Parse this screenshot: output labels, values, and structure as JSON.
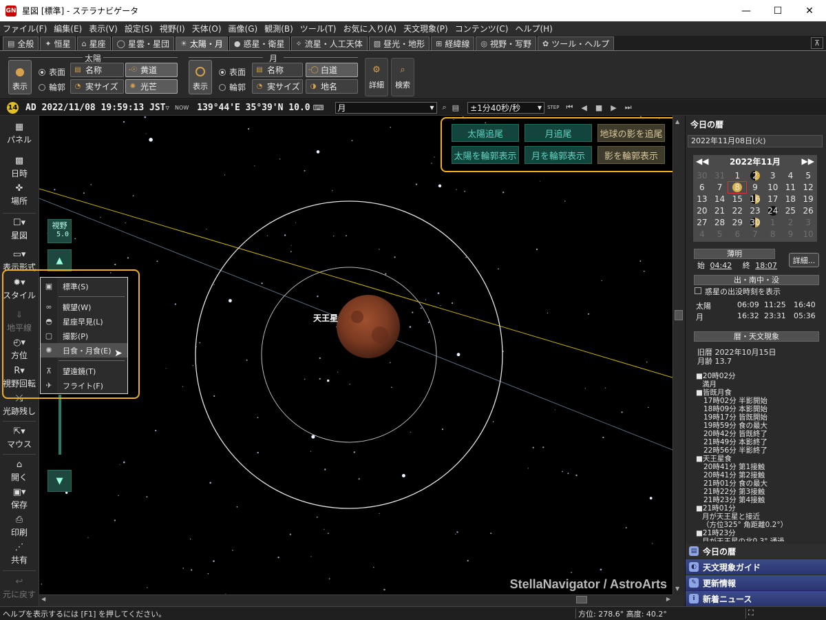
{
  "window": {
    "app_icon_text": "GN",
    "title": "星図 [標準] - ステラナビゲータ",
    "minimize": "—",
    "maximize": "☐",
    "close": "✕"
  },
  "menu": [
    "ファイル(F)",
    "編集(E)",
    "表示(V)",
    "設定(S)",
    "視野(I)",
    "天体(O)",
    "画像(G)",
    "観測(B)",
    "ツール(T)",
    "お気に入り(A)",
    "天文現象(P)",
    "コンテンツ(C)",
    "ヘルプ(H)"
  ],
  "tabs": [
    {
      "icon": "▤",
      "label": "全般"
    },
    {
      "icon": "✦",
      "label": "恒星"
    },
    {
      "icon": "⌂",
      "label": "星座"
    },
    {
      "icon": "◯",
      "label": "星雲・星団"
    },
    {
      "icon": "☀",
      "label": "太陽・月"
    },
    {
      "icon": "●",
      "label": "惑星・衛星"
    },
    {
      "icon": "✧",
      "label": "流星・人工天体"
    },
    {
      "icon": "▧",
      "label": "昼光・地形"
    },
    {
      "icon": "⊞",
      "label": "経緯線"
    },
    {
      "icon": "◎",
      "label": "視野・写野"
    },
    {
      "icon": "✿",
      "label": "ツール・ヘルプ"
    }
  ],
  "active_tab_index": 4,
  "pin_icon": "⊼",
  "ribbon": {
    "sun": {
      "group": "太陽",
      "show": "表示",
      "radio_surface": "表面",
      "radio_outline": "輪郭",
      "name": "名称",
      "real_size": "実サイズ",
      "ecliptic": "黄道",
      "corona": "光芒"
    },
    "moon": {
      "group": "月",
      "show": "表示",
      "radio_surface": "表面",
      "radio_outline": "輪郭",
      "name": "名称",
      "real_size": "実サイズ",
      "white_path": "白道",
      "place_name": "地名"
    },
    "detail": "詳細",
    "search": "検索"
  },
  "timebar": {
    "moon_age": "14",
    "datetime": "AD 2022/11/08 19:59:13 JST",
    "tz_mark": "▿",
    "now_label": "NOW",
    "location": "139°44'E 35°39'N 10.0",
    "target": "月",
    "step": "±1分40秒/秒",
    "step_label": "STEP"
  },
  "left_toolbar": [
    {
      "name": "panel",
      "label": "パネル",
      "icon": "▦"
    },
    {
      "name": "datetime",
      "label": "日時",
      "icon": "▩"
    },
    {
      "name": "location",
      "label": "場所",
      "icon": "✜"
    },
    {
      "name": "star-chart",
      "label": "星図",
      "icon": "☐▾"
    },
    {
      "name": "display-format",
      "label": "表示形式",
      "icon": "▭▾"
    },
    {
      "name": "style",
      "label": "スタイル",
      "icon": "✹▾"
    },
    {
      "name": "horizon",
      "label": "地平線",
      "icon": "⇓"
    },
    {
      "name": "direction",
      "label": "方位",
      "icon": "◴▾"
    },
    {
      "name": "rotate-view",
      "label": "視野回転",
      "icon": "R▾"
    },
    {
      "name": "trails",
      "label": "光跡残し",
      "icon": "⤯"
    },
    {
      "name": "mouse",
      "label": "マウス",
      "icon": "⇱▾"
    },
    {
      "name": "open",
      "label": "開く",
      "icon": "⌂"
    },
    {
      "name": "save",
      "label": "保存",
      "icon": "▣▾"
    },
    {
      "name": "print",
      "label": "印刷",
      "icon": "⎙"
    },
    {
      "name": "share",
      "label": "共有",
      "icon": "⋰"
    },
    {
      "name": "undo",
      "label": "元に戻す",
      "icon": "↩"
    }
  ],
  "style_menu": [
    {
      "icon": "▣",
      "label": "標準(S)"
    },
    {
      "icon": "∞",
      "label": "観望(W)"
    },
    {
      "icon": "◓",
      "label": "星座早見(L)"
    },
    {
      "icon": "▢",
      "label": "撮影(P)"
    },
    {
      "icon": "✺",
      "label": "日食・月食(E)"
    },
    {
      "icon": "⊼",
      "label": "望遠鏡(T)"
    },
    {
      "icon": "✈",
      "label": "フライト(F)"
    }
  ],
  "sky": {
    "fov_label": "視野",
    "fov_value": "5.0",
    "up_icon": "▲",
    "down_icon": "▼",
    "object_label": "天王星",
    "watermark": "StellaNavigator / AstroArts",
    "tracking": {
      "sun_track": "太陽追尾",
      "moon_track": "月追尾",
      "shadow_track": "地球の影を追尾",
      "sun_outline": "太陽を輪郭表示",
      "moon_outline": "月を輪郭表示",
      "shadow_outline": "影を輪郭表示"
    }
  },
  "right_panel": {
    "title": "今日の暦",
    "date": "2022年11月08日(火)",
    "calendar": {
      "month": "2022年11月",
      "prev2": "◀◀",
      "next2": "▶▶",
      "days": [
        {
          "d": "30",
          "o": true
        },
        {
          "d": "31",
          "o": true
        },
        {
          "d": "1"
        },
        {
          "d": "2"
        },
        {
          "d": "3"
        },
        {
          "d": "4"
        },
        {
          "d": "5"
        },
        {
          "d": "6"
        },
        {
          "d": "7"
        },
        {
          "d": "8",
          "sel": true
        },
        {
          "d": "9"
        },
        {
          "d": "10"
        },
        {
          "d": "11"
        },
        {
          "d": "12"
        },
        {
          "d": "13"
        },
        {
          "d": "14"
        },
        {
          "d": "15"
        },
        {
          "d": "16"
        },
        {
          "d": "17"
        },
        {
          "d": "18"
        },
        {
          "d": "19"
        },
        {
          "d": "20"
        },
        {
          "d": "21"
        },
        {
          "d": "22"
        },
        {
          "d": "23"
        },
        {
          "d": "24"
        },
        {
          "d": "25"
        },
        {
          "d": "26"
        },
        {
          "d": "27"
        },
        {
          "d": "28"
        },
        {
          "d": "29"
        },
        {
          "d": "30"
        },
        {
          "d": "1",
          "o": true
        },
        {
          "d": "2",
          "o": true
        },
        {
          "d": "3",
          "o": true
        },
        {
          "d": "4",
          "o": true
        },
        {
          "d": "5",
          "o": true
        },
        {
          "d": "6",
          "o": true
        },
        {
          "d": "7",
          "o": true
        },
        {
          "d": "8",
          "o": true
        },
        {
          "d": "9",
          "o": true
        },
        {
          "d": "10",
          "o": true
        }
      ]
    },
    "twilight": {
      "title": "薄明",
      "start_label": "始",
      "start": "04:42",
      "end_label": "終",
      "end": "18:07",
      "detail": "詳細..."
    },
    "rise_set": {
      "title": "出・南中・没",
      "checkbox_label": "惑星の出没時刻を表示",
      "rows": [
        {
          "body": "太陽",
          "rise": "06:09",
          "transit": "11:25",
          "set": "16:40"
        },
        {
          "body": "月",
          "rise": "16:32",
          "transit": "23:31",
          "set": "05:36"
        }
      ]
    },
    "calendar_events": {
      "title": "暦・天文現象",
      "lunar": "旧暦  2022年10月15日",
      "moon_age": "月齢  13.7",
      "items": [
        {
          "t": "■20時02分",
          "c": ""
        },
        {
          "t": "満月",
          "c": "ind1"
        },
        {
          "t": "■皆既月食",
          "c": ""
        },
        {
          "t": "17時02分  半影開始",
          "c": "ind2"
        },
        {
          "t": "18時09分  本影開始",
          "c": "ind2"
        },
        {
          "t": "19時17分  皆既開始",
          "c": "ind2"
        },
        {
          "t": "19時59分  食の最大",
          "c": "ind2"
        },
        {
          "t": "20時42分  皆既終了",
          "c": "ind2"
        },
        {
          "t": "21時49分  本影終了",
          "c": "ind2"
        },
        {
          "t": "22時56分  半影終了",
          "c": "ind2"
        },
        {
          "t": "■天王星食",
          "c": ""
        },
        {
          "t": "20時41分  第1接触",
          "c": "ind2"
        },
        {
          "t": "20時41分  第2接触",
          "c": "ind2"
        },
        {
          "t": "21時01分  食の最大",
          "c": "ind2"
        },
        {
          "t": "21時22分  第3接触",
          "c": "ind2"
        },
        {
          "t": "21時23分  第4接触",
          "c": "ind2"
        },
        {
          "t": "■21時01分",
          "c": ""
        },
        {
          "t": "月が天王星と接近",
          "c": "ind1"
        },
        {
          "t": "（方位325°  角距離0.2°）",
          "c": "ind1"
        },
        {
          "t": "■21時23分",
          "c": ""
        },
        {
          "t": "月が天王星の北0.3°  通過",
          "c": "ind1"
        }
      ]
    },
    "navs": [
      {
        "icon": "▤",
        "label": "今日の暦"
      },
      {
        "icon": "◐",
        "label": "天文現象ガイド"
      },
      {
        "icon": "✎",
        "label": "更新情報"
      },
      {
        "icon": "i",
        "label": "新着ニュース"
      }
    ]
  },
  "status": {
    "help": "ヘルプを表示するには [F1] を押してください。",
    "position": "方位:  278.6°  高度:   40.2°",
    "fullscreen_icon": "⛶"
  }
}
